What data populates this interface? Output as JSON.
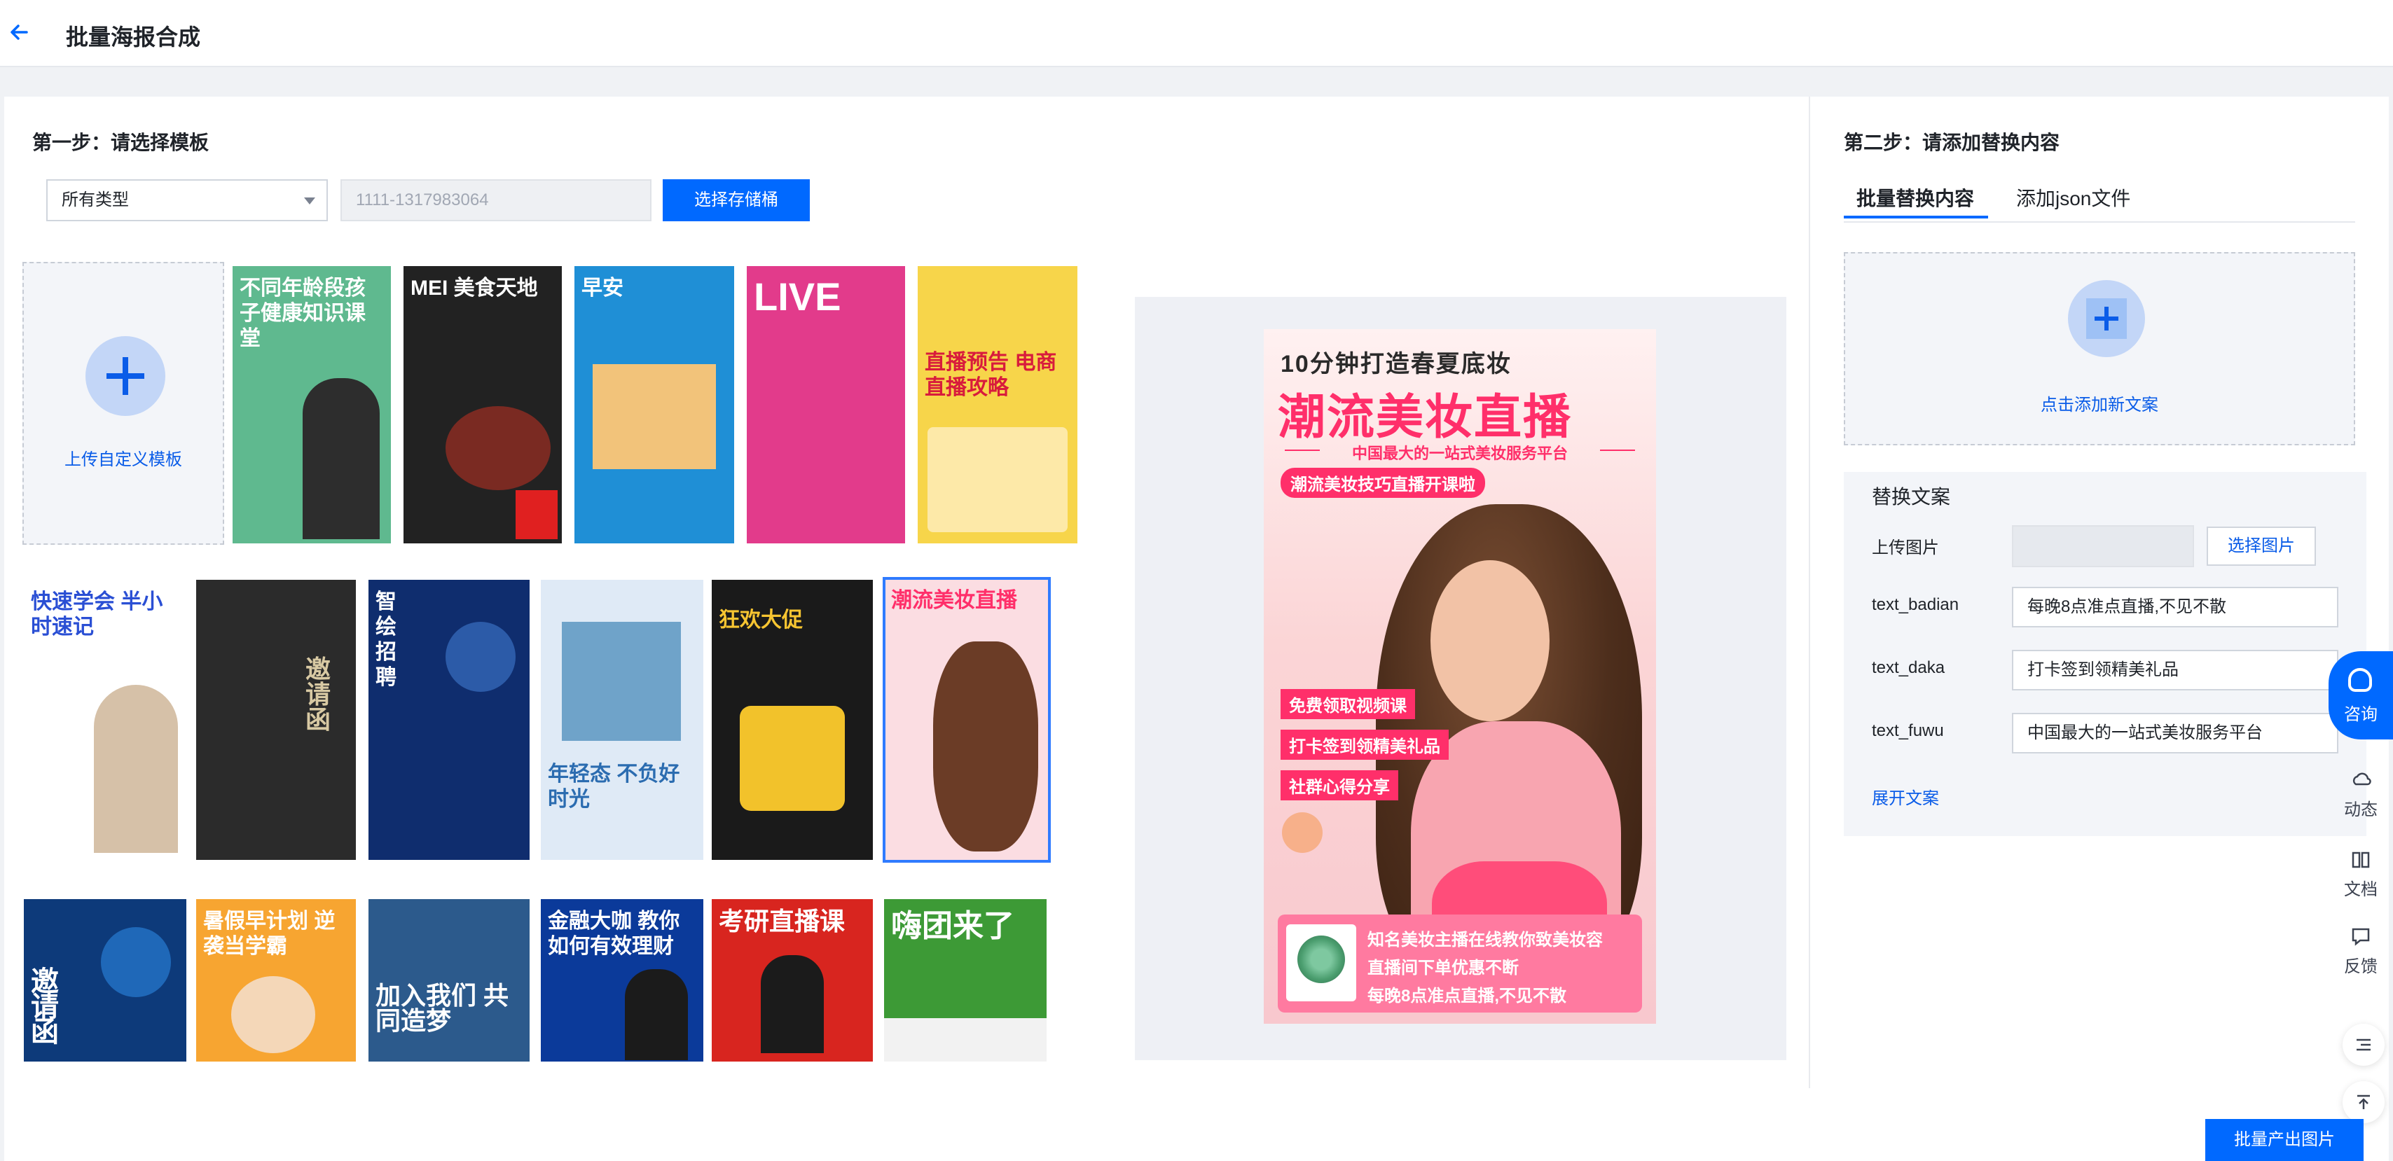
{
  "header": {
    "title": "批量海报合成"
  },
  "step1": {
    "title": "第一步：请选择模板",
    "type_select": "所有类型",
    "bucket_placeholder": "1111-1317983064",
    "bucket_button": "选择存储桶",
    "upload_label": "上传自定义模板"
  },
  "templates": [
    {
      "title": "不同年龄段孩子健康知识课堂",
      "bg": "#5fb98f",
      "fg": "#ffffff"
    },
    {
      "title": "MEI 美食天地",
      "bg": "#222222",
      "fg": "#ffffff"
    },
    {
      "title": "早安",
      "bg": "#1f8fd6",
      "fg": "#ffffff"
    },
    {
      "title": "LIVE",
      "bg": "#e23b8b",
      "fg": "#ffffff"
    },
    {
      "title": "直播预告 电商直播攻略",
      "bg": "#f7d54a",
      "fg": "#d81b3c"
    },
    {
      "title": "快速学会 半小时速记",
      "bg": "#ffffff",
      "fg": "#2a4fd4"
    },
    {
      "title": "邀请函",
      "bg": "#2b2b2b",
      "fg": "#d8c9a3"
    },
    {
      "title": "智绘招聘",
      "bg": "#0f2d6e",
      "fg": "#ffffff"
    },
    {
      "title": "年轻态 不负好时光",
      "bg": "#dfeaf6",
      "fg": "#2b6cb0"
    },
    {
      "title": "狂欢大促",
      "bg": "#1a1a1a",
      "fg": "#f7c531"
    },
    {
      "title": "潮流美妆直播",
      "bg": "#fbdde2",
      "fg": "#ff2f6a"
    },
    {
      "title": "邀请函",
      "bg": "#0d3a7a",
      "fg": "#ffffff"
    },
    {
      "title": "暑假早计划 逆袭当学霸",
      "bg": "#f7a531",
      "fg": "#ffffff"
    },
    {
      "title": "加入我们 共同造梦",
      "bg": "#2c5a8c",
      "fg": "#ffffff"
    },
    {
      "title": "金融大咖 教你如何有效理财",
      "bg": "#0b3a9a",
      "fg": "#ffffff"
    },
    {
      "title": "考研直播课",
      "bg": "#d8251f",
      "fg": "#ffffff"
    },
    {
      "title": "嗨团来了",
      "bg": "#3d9a36",
      "fg": "#ffffff"
    }
  ],
  "preview": {
    "line1": "10分钟打造春夏底妆",
    "line2": "潮流美妆直播",
    "line3": "中国最大的一站式美妆服务平台",
    "tag": "潮流美妆技巧直播开课啦",
    "badges": [
      "免费领取视频课",
      "打卡签到领精美礼品",
      "社群心得分享"
    ],
    "info": [
      "知名美妆主播在线教你致美妆容",
      "直播间下单优惠不断",
      "每晚8点准点直播,不见不散"
    ]
  },
  "step2": {
    "title": "第二步：请添加替换内容",
    "tabs": [
      "批量替换内容",
      "添加json文件"
    ],
    "add_label": "点击添加新文案",
    "panel_title": "替换文案",
    "upload_image_label": "上传图片",
    "select_image_button": "选择图片",
    "fields": [
      {
        "key": "text_badian",
        "value": "每晚8点准点直播,不见不散"
      },
      {
        "key": "text_daka",
        "value": "打卡签到领精美礼品"
      },
      {
        "key": "text_fuwu",
        "value": "中国最大的一站式美妆服务平台"
      }
    ],
    "expand_link": "展开文案"
  },
  "side_tools": {
    "consult": "咨询",
    "dynamic": "动态",
    "docs": "文档",
    "feedback": "反馈"
  },
  "submit_button": "批量产出图片",
  "colors": {
    "primary": "#0069ff",
    "link": "#0a5ce8"
  }
}
